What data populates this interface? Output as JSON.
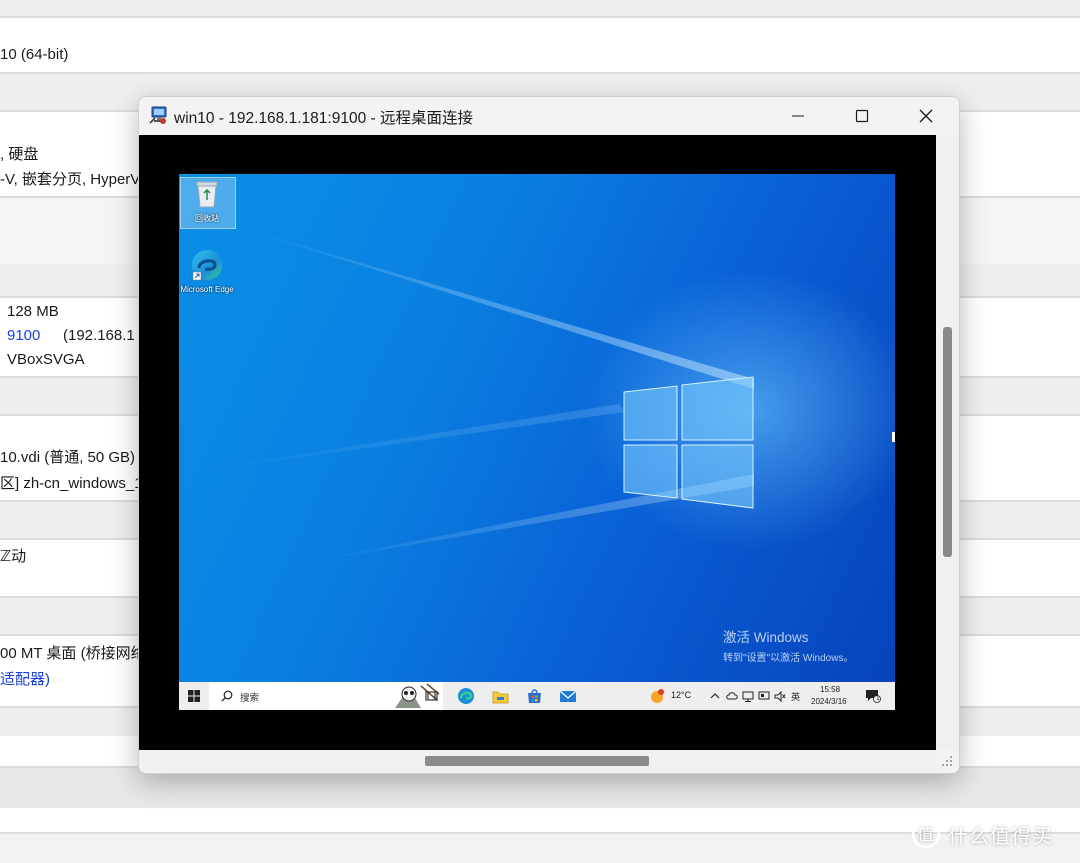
{
  "background_panel": {
    "lines": [
      "10 (64-bit)",
      ", 硬盘",
      "-V, 嵌套分页, HyperV",
      "128 MB",
      "9100",
      "(192.168.1",
      "VBoxSVGA",
      "10.vdi (普通, 50 GB)",
      "区] zh-cn_windows_1",
      "ℤ动",
      "00 MT 桌面 (桥接网络",
      "适配器)"
    ]
  },
  "rdp_window": {
    "title": "win10 - 192.168.1.181:9100 - 远程桌面连接",
    "icon": "remote-desktop-icon",
    "buttons": [
      "minimize-icon",
      "maximize-icon",
      "close-icon"
    ]
  },
  "desktop": {
    "icons": [
      {
        "label": "回收站",
        "icon": "recycle-bin-icon"
      },
      {
        "label": "Microsoft Edge",
        "icon": "edge-icon"
      }
    ],
    "activation": {
      "line1": "激活 Windows",
      "line2": "转到\"设置\"以激活 Windows。"
    }
  },
  "taskbar": {
    "start_icon": "windows-start-icon",
    "search_placeholder": "搜索",
    "weather": "12°C",
    "ime": "英",
    "time": "15:58",
    "date": "2024/3/16",
    "notification_count": "1",
    "pinned": [
      "task-view-icon",
      "edge-icon",
      "file-explorer-icon",
      "store-icon",
      "mail-icon"
    ]
  },
  "watermark": {
    "text": "什么值得买",
    "icon": "smzdm-logo-icon"
  },
  "colors": {
    "desktop_blue": "#0a7fe0",
    "link_blue": "#1a3fd8",
    "titlebar": "#f3f3f3"
  }
}
